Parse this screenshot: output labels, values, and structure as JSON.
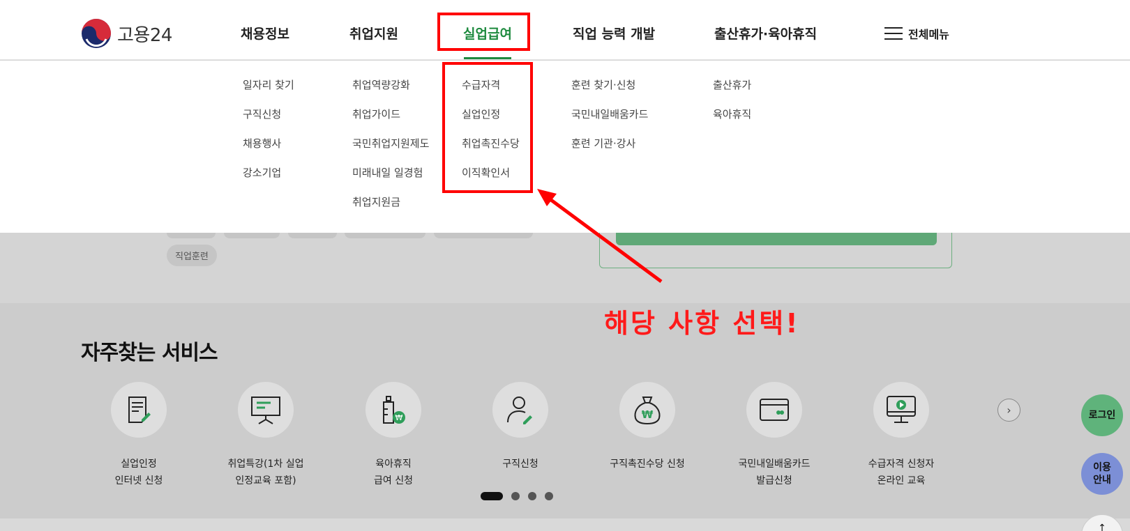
{
  "header": {
    "logo_text": "고용24",
    "nav": [
      {
        "label": "채용정보"
      },
      {
        "label": "취업지원"
      },
      {
        "label": "실업급여"
      },
      {
        "label": "직업 능력 개발"
      },
      {
        "label": "출산휴가·육아휴직"
      }
    ],
    "active_nav": "실업급여",
    "menu_all_label": "전체메뉴"
  },
  "dropdown": {
    "col1": [
      "일자리 찾기",
      "구직신청",
      "채용행사",
      "강소기업"
    ],
    "col2": [
      "취업역량강화",
      "취업가이드",
      "국민취업지원제도",
      "미래내일 일경험",
      "취업지원금"
    ],
    "col3": [
      "수급자격",
      "실업인정",
      "취업촉진수당",
      "이직확인서"
    ],
    "col4": [
      "훈련 찾기·신청",
      "국민내일배움카드",
      "훈련 기관·강사"
    ],
    "col5": [
      "출산휴가",
      "육아휴직"
    ]
  },
  "search": {
    "chip_label": "직업훈련"
  },
  "services": {
    "title": "자주찾는 서비스",
    "items": [
      {
        "label": "실업인정\n인터넷 신청",
        "icon": "document-edit-icon"
      },
      {
        "label": "취업특강(1차 실업\n인정교육 포함)",
        "icon": "presentation-board-icon"
      },
      {
        "label": "육아휴직\n급여 신청",
        "icon": "baby-bottle-won-icon"
      },
      {
        "label": "구직신청",
        "icon": "person-edit-icon"
      },
      {
        "label": "구직촉진수당 신청",
        "icon": "money-bag-won-icon"
      },
      {
        "label": "국민내일배움카드\n발급신청",
        "icon": "card-icon"
      },
      {
        "label": "수급자격 신청자\n온라인 교육",
        "icon": "monitor-play-icon"
      }
    ],
    "next_icon": "chevron-right-icon",
    "pages": 4,
    "active_page": 1
  },
  "floating": {
    "login": "로그인",
    "guide": "이용\n안내",
    "top": "↑"
  },
  "annotation": {
    "text": "해당 사항 선택!",
    "color": "#ff0000"
  },
  "colors": {
    "accent_green": "#1d8a3e",
    "login_green": "#5fb37b",
    "guide_blue": "#7c8fd6"
  }
}
